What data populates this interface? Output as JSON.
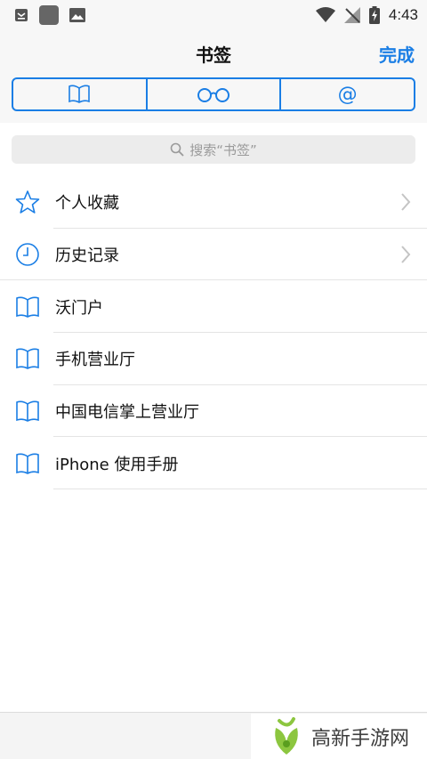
{
  "status_bar": {
    "time": "4:43",
    "icons": [
      "notification-app-icon",
      "notification-square-icon",
      "image-icon",
      "wifi-icon",
      "no-sim-icon",
      "battery-charging-icon"
    ]
  },
  "nav": {
    "title": "书签",
    "done_label": "完成"
  },
  "segments": [
    {
      "icon": "bookmarks-book-icon",
      "selected": true
    },
    {
      "icon": "reading-list-glasses-icon",
      "selected": false
    },
    {
      "icon": "shared-links-at-icon",
      "label": "@",
      "selected": false
    }
  ],
  "search": {
    "placeholder": "搜索“书签”"
  },
  "list": {
    "items": [
      {
        "label": "个人收藏",
        "icon": "star-icon",
        "has_chevron": true
      },
      {
        "label": "历史记录",
        "icon": "clock-icon",
        "has_chevron": true
      },
      {
        "label": "沃门户",
        "icon": "book-icon",
        "has_chevron": false
      },
      {
        "label": "手机营业厅",
        "icon": "book-icon",
        "has_chevron": false
      },
      {
        "label": "中国电信掌上营业厅",
        "icon": "book-icon",
        "has_chevron": false
      },
      {
        "label": "iPhone 使用手册",
        "icon": "book-icon",
        "has_chevron": false
      }
    ]
  },
  "watermark": {
    "text": "高新手游网",
    "icon": "logo-leaf-icon"
  },
  "colors": {
    "accent": "#1a7ee5",
    "background": "#f7f7f7",
    "list_background": "#ffffff"
  }
}
